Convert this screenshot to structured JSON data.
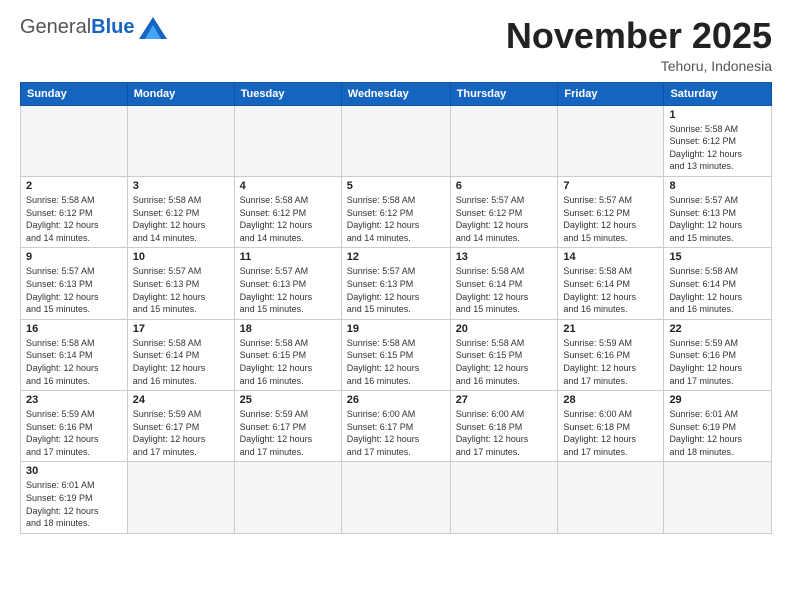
{
  "logo": {
    "general": "General",
    "blue": "Blue"
  },
  "title": "November 2025",
  "subtitle": "Tehoru, Indonesia",
  "weekdays": [
    "Sunday",
    "Monday",
    "Tuesday",
    "Wednesday",
    "Thursday",
    "Friday",
    "Saturday"
  ],
  "days": [
    {
      "num": "",
      "info": ""
    },
    {
      "num": "",
      "info": ""
    },
    {
      "num": "",
      "info": ""
    },
    {
      "num": "",
      "info": ""
    },
    {
      "num": "",
      "info": ""
    },
    {
      "num": "",
      "info": ""
    },
    {
      "num": "1",
      "info": "Sunrise: 5:58 AM\nSunset: 6:12 PM\nDaylight: 12 hours\nand 13 minutes."
    },
    {
      "num": "2",
      "info": "Sunrise: 5:58 AM\nSunset: 6:12 PM\nDaylight: 12 hours\nand 14 minutes."
    },
    {
      "num": "3",
      "info": "Sunrise: 5:58 AM\nSunset: 6:12 PM\nDaylight: 12 hours\nand 14 minutes."
    },
    {
      "num": "4",
      "info": "Sunrise: 5:58 AM\nSunset: 6:12 PM\nDaylight: 12 hours\nand 14 minutes."
    },
    {
      "num": "5",
      "info": "Sunrise: 5:58 AM\nSunset: 6:12 PM\nDaylight: 12 hours\nand 14 minutes."
    },
    {
      "num": "6",
      "info": "Sunrise: 5:57 AM\nSunset: 6:12 PM\nDaylight: 12 hours\nand 14 minutes."
    },
    {
      "num": "7",
      "info": "Sunrise: 5:57 AM\nSunset: 6:12 PM\nDaylight: 12 hours\nand 15 minutes."
    },
    {
      "num": "8",
      "info": "Sunrise: 5:57 AM\nSunset: 6:13 PM\nDaylight: 12 hours\nand 15 minutes."
    },
    {
      "num": "9",
      "info": "Sunrise: 5:57 AM\nSunset: 6:13 PM\nDaylight: 12 hours\nand 15 minutes."
    },
    {
      "num": "10",
      "info": "Sunrise: 5:57 AM\nSunset: 6:13 PM\nDaylight: 12 hours\nand 15 minutes."
    },
    {
      "num": "11",
      "info": "Sunrise: 5:57 AM\nSunset: 6:13 PM\nDaylight: 12 hours\nand 15 minutes."
    },
    {
      "num": "12",
      "info": "Sunrise: 5:57 AM\nSunset: 6:13 PM\nDaylight: 12 hours\nand 15 minutes."
    },
    {
      "num": "13",
      "info": "Sunrise: 5:58 AM\nSunset: 6:14 PM\nDaylight: 12 hours\nand 15 minutes."
    },
    {
      "num": "14",
      "info": "Sunrise: 5:58 AM\nSunset: 6:14 PM\nDaylight: 12 hours\nand 16 minutes."
    },
    {
      "num": "15",
      "info": "Sunrise: 5:58 AM\nSunset: 6:14 PM\nDaylight: 12 hours\nand 16 minutes."
    },
    {
      "num": "16",
      "info": "Sunrise: 5:58 AM\nSunset: 6:14 PM\nDaylight: 12 hours\nand 16 minutes."
    },
    {
      "num": "17",
      "info": "Sunrise: 5:58 AM\nSunset: 6:14 PM\nDaylight: 12 hours\nand 16 minutes."
    },
    {
      "num": "18",
      "info": "Sunrise: 5:58 AM\nSunset: 6:15 PM\nDaylight: 12 hours\nand 16 minutes."
    },
    {
      "num": "19",
      "info": "Sunrise: 5:58 AM\nSunset: 6:15 PM\nDaylight: 12 hours\nand 16 minutes."
    },
    {
      "num": "20",
      "info": "Sunrise: 5:58 AM\nSunset: 6:15 PM\nDaylight: 12 hours\nand 16 minutes."
    },
    {
      "num": "21",
      "info": "Sunrise: 5:59 AM\nSunset: 6:16 PM\nDaylight: 12 hours\nand 17 minutes."
    },
    {
      "num": "22",
      "info": "Sunrise: 5:59 AM\nSunset: 6:16 PM\nDaylight: 12 hours\nand 17 minutes."
    },
    {
      "num": "23",
      "info": "Sunrise: 5:59 AM\nSunset: 6:16 PM\nDaylight: 12 hours\nand 17 minutes."
    },
    {
      "num": "24",
      "info": "Sunrise: 5:59 AM\nSunset: 6:17 PM\nDaylight: 12 hours\nand 17 minutes."
    },
    {
      "num": "25",
      "info": "Sunrise: 5:59 AM\nSunset: 6:17 PM\nDaylight: 12 hours\nand 17 minutes."
    },
    {
      "num": "26",
      "info": "Sunrise: 6:00 AM\nSunset: 6:17 PM\nDaylight: 12 hours\nand 17 minutes."
    },
    {
      "num": "27",
      "info": "Sunrise: 6:00 AM\nSunset: 6:18 PM\nDaylight: 12 hours\nand 17 minutes."
    },
    {
      "num": "28",
      "info": "Sunrise: 6:00 AM\nSunset: 6:18 PM\nDaylight: 12 hours\nand 17 minutes."
    },
    {
      "num": "29",
      "info": "Sunrise: 6:01 AM\nSunset: 6:19 PM\nDaylight: 12 hours\nand 18 minutes."
    },
    {
      "num": "30",
      "info": "Sunrise: 6:01 AM\nSunset: 6:19 PM\nDaylight: 12 hours\nand 18 minutes."
    }
  ]
}
